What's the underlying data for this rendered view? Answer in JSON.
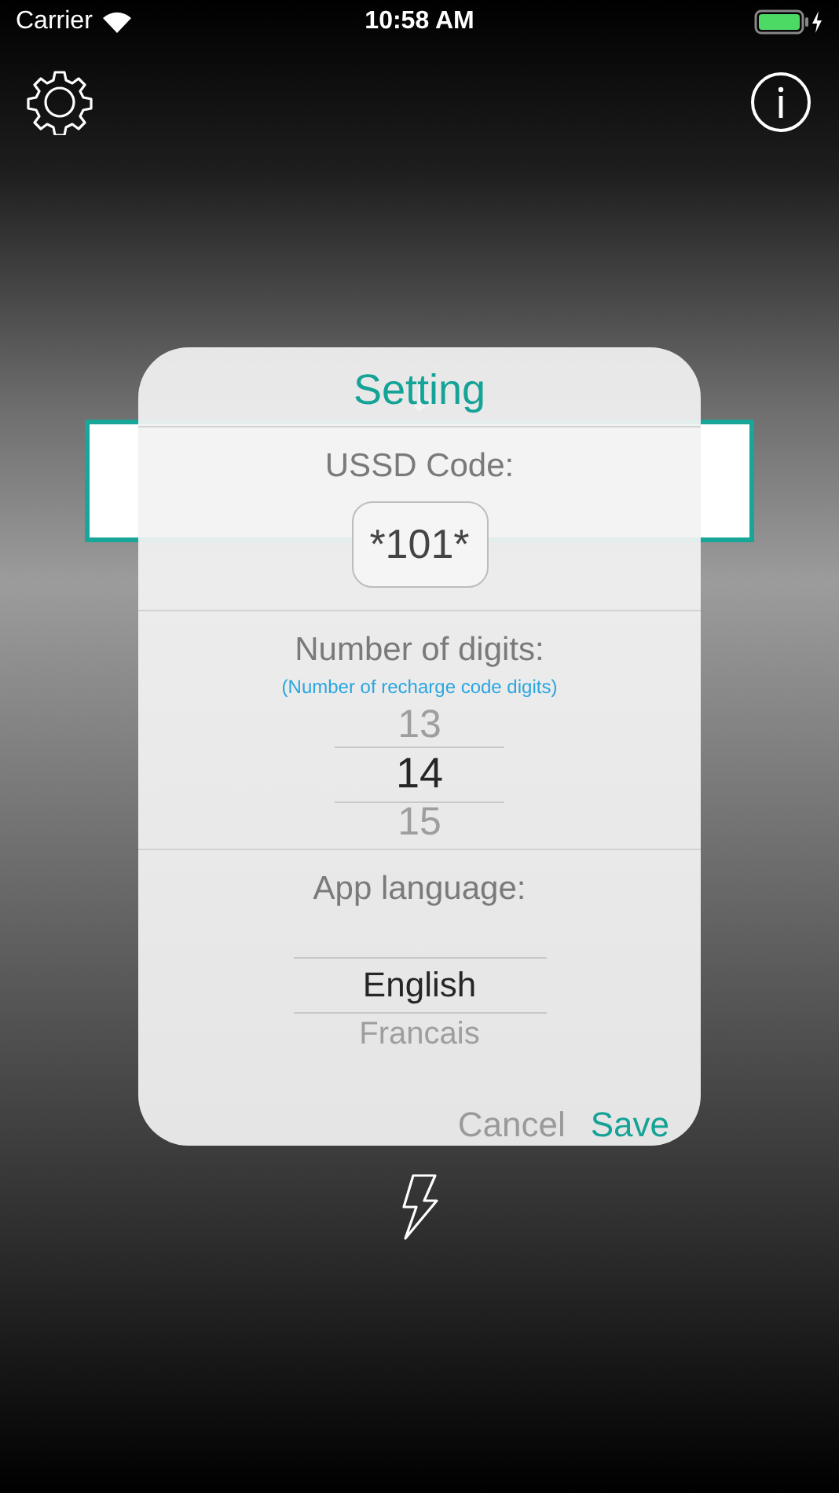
{
  "status_bar": {
    "carrier": "Carrier",
    "time": "10:58 AM",
    "battery": {
      "level": 1.0,
      "charging": true
    }
  },
  "dialog": {
    "title": "Setting",
    "ussd": {
      "label": "USSD Code:",
      "value": "*101*"
    },
    "digits": {
      "label": "Number of digits:",
      "hint": "(Number of recharge code digits)",
      "options": [
        {
          "label": "13",
          "selected": false
        },
        {
          "label": "14",
          "selected": true
        },
        {
          "label": "15",
          "selected": false
        }
      ]
    },
    "language": {
      "label": "App language:",
      "options": [
        {
          "label": "English",
          "selected": true
        },
        {
          "label": "Francais",
          "selected": false
        }
      ]
    },
    "buttons": [
      {
        "label": "Cancel",
        "kind": "secondary"
      },
      {
        "label": "Save",
        "kind": "primary"
      }
    ]
  }
}
